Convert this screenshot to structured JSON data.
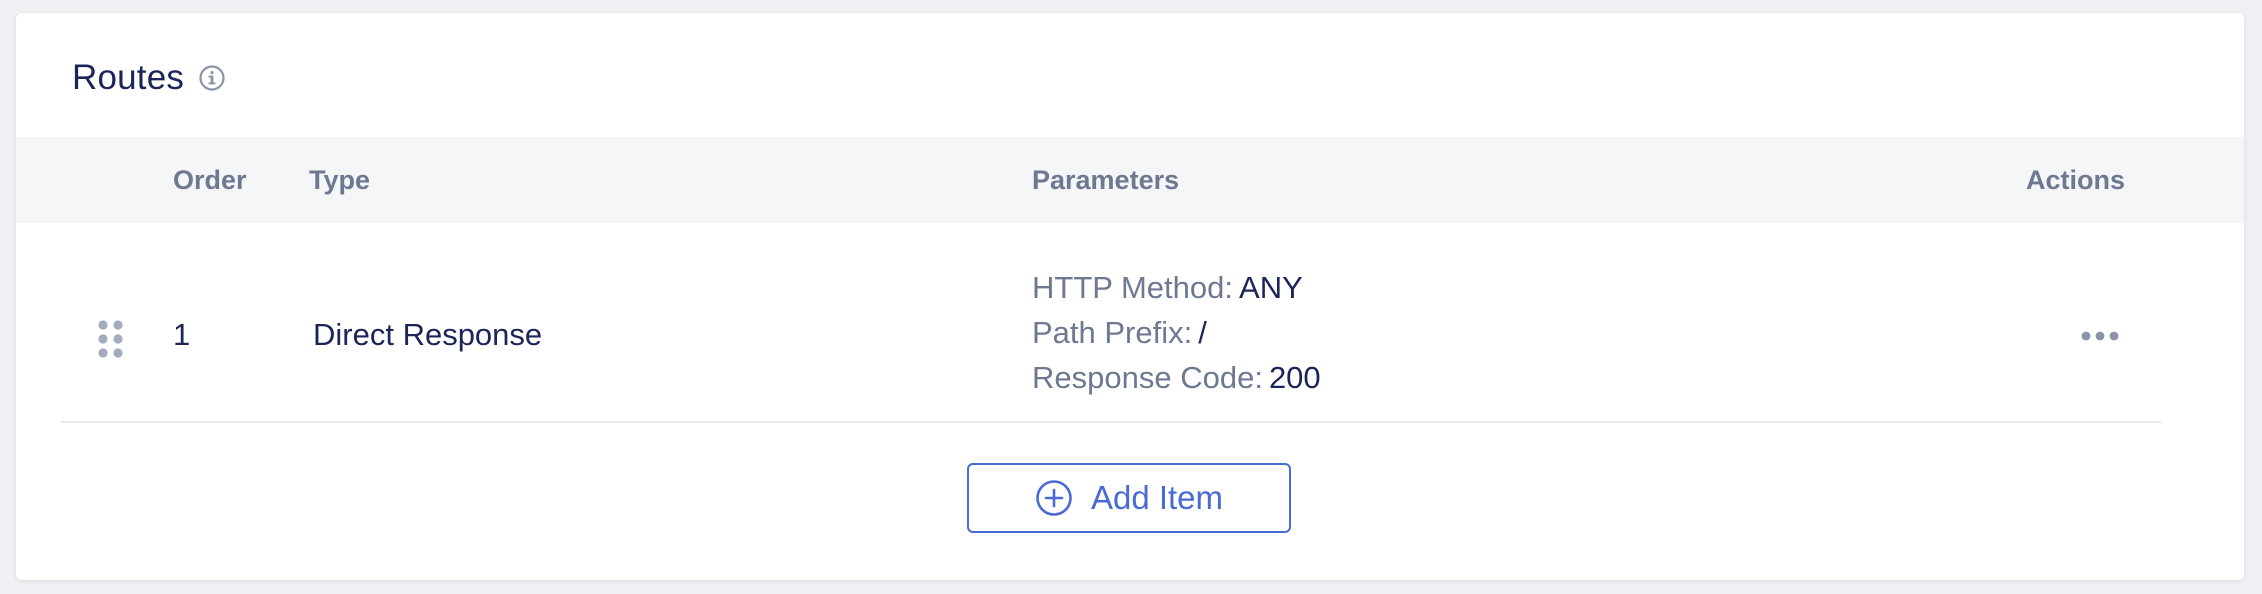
{
  "card": {
    "title": "Routes",
    "title_icon": "info-icon"
  },
  "table": {
    "headers": {
      "order": "Order",
      "type": "Type",
      "parameters": "Parameters",
      "actions": "Actions"
    },
    "rows": [
      {
        "order": "1",
        "type": "Direct Response",
        "parameters": [
          {
            "key": "HTTP Method:",
            "value": "ANY"
          },
          {
            "key": "Path Prefix:",
            "value": "/"
          },
          {
            "key": "Response Code:",
            "value": "200"
          }
        ],
        "drag_icon": "drag-handle-icon",
        "actions_icon": "more-horizontal-icon"
      }
    ]
  },
  "add_button": {
    "label": "Add Item",
    "icon": "plus-circle-icon"
  },
  "colors": {
    "title": "#1b2559",
    "muted": "#6e7891",
    "accent": "#4a6ad4",
    "header_bg": "#f5f6f8"
  }
}
